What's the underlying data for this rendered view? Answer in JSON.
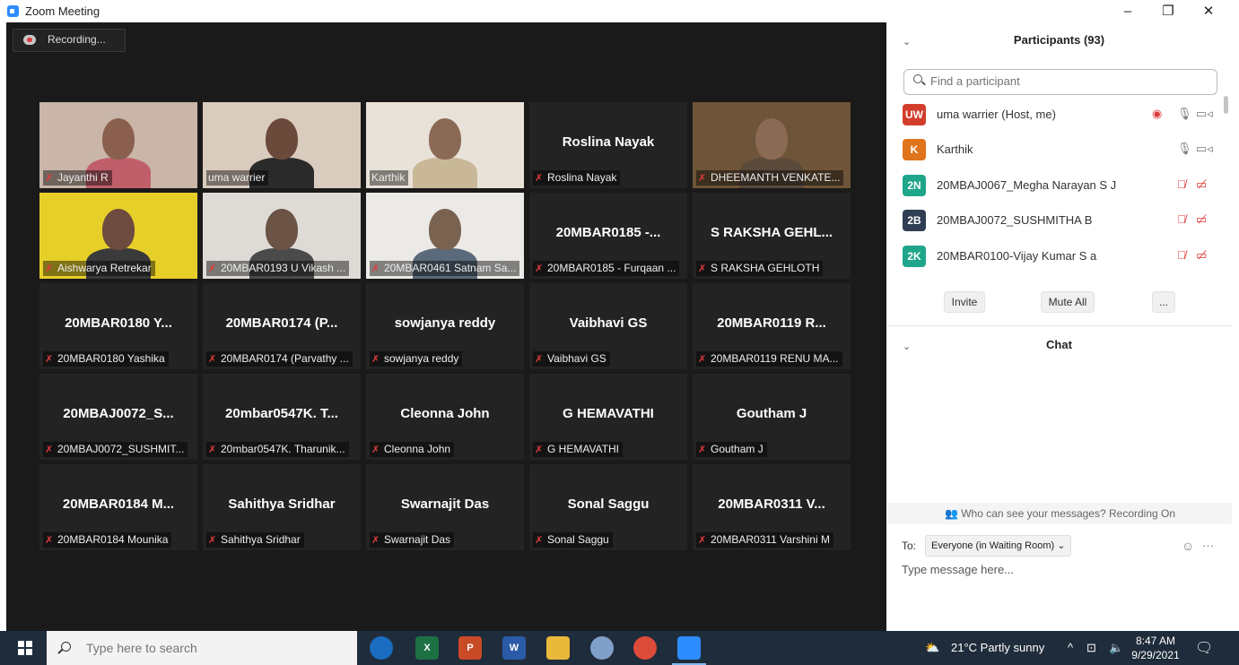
{
  "window": {
    "title": "Zoom Meeting",
    "controls": [
      "–",
      "❐",
      "✕"
    ]
  },
  "recording": {
    "label": "Recording..."
  },
  "gallery": [
    {
      "id": "jayanthi",
      "name": "",
      "label": "Jayanthi R",
      "video": true
    },
    {
      "id": "uma",
      "name": "",
      "label": "uma warrier",
      "video": true,
      "unmuted": true
    },
    {
      "id": "karthik",
      "name": "",
      "label": "Karthik",
      "video": true,
      "unmuted": true,
      "active": true
    },
    {
      "id": "roslina",
      "name": "Roslina Nayak",
      "label": "Roslina Nayak",
      "video": false
    },
    {
      "id": "dheemanth",
      "name": "",
      "label": "DHEEMANTH VENKATE...",
      "video": true
    },
    {
      "id": "aishwarya",
      "name": "",
      "label": "Aishwarya Retrekar",
      "video": true
    },
    {
      "id": "vikash",
      "name": "",
      "label": "20MBAR0193 U Vikash ...",
      "video": true
    },
    {
      "id": "satnam",
      "name": "",
      "label": "20MBAR0461 Satnam Sa...",
      "video": true
    },
    {
      "id": "furqaan",
      "name": "20MBAR0185 -...",
      "label": "20MBAR0185 - Furqaan ...",
      "video": false
    },
    {
      "id": "raksha",
      "name": "S RAKSHA GEHL...",
      "label": "S RAKSHA GEHLOTH",
      "video": false
    },
    {
      "id": "yashika",
      "name": "20MBAR0180 Y...",
      "label": "20MBAR0180 Yashika",
      "video": false
    },
    {
      "id": "parvathy",
      "name": "20MBAR0174 (P...",
      "label": "20MBAR0174 (Parvathy ...",
      "video": false
    },
    {
      "id": "sowjanya",
      "name": "sowjanya reddy",
      "label": "sowjanya reddy",
      "video": false
    },
    {
      "id": "vaibhavi",
      "name": "Vaibhavi GS",
      "label": "Vaibhavi GS",
      "video": false
    },
    {
      "id": "renu",
      "name": "20MBAR0119 R...",
      "label": "20MBAR0119 RENU MA...",
      "video": false
    },
    {
      "id": "sushmitha",
      "name": "20MBAJ0072_S...",
      "label": "20MBAJ0072_SUSHMIT...",
      "video": false
    },
    {
      "id": "tharunika",
      "name": "20mbar0547K. T...",
      "label": "20mbar0547K. Tharunik...",
      "video": false
    },
    {
      "id": "cleonna",
      "name": "Cleonna John",
      "label": "Cleonna John",
      "video": false
    },
    {
      "id": "hemavathi",
      "name": "G HEMAVATHI",
      "label": "G HEMAVATHI",
      "video": false
    },
    {
      "id": "goutham",
      "name": "Goutham J",
      "label": "Goutham J",
      "video": false
    },
    {
      "id": "mounika",
      "name": "20MBAR0184 M...",
      "label": "20MBAR0184 Mounika",
      "video": false
    },
    {
      "id": "sahithya",
      "name": "Sahithya Sridhar",
      "label": "Sahithya Sridhar",
      "video": false
    },
    {
      "id": "swarnajit",
      "name": "Swarnajit Das",
      "label": "Swarnajit Das",
      "video": false
    },
    {
      "id": "sonal",
      "name": "Sonal Saggu",
      "label": "Sonal Saggu",
      "video": false
    },
    {
      "id": "varshini",
      "name": "20MBAR0311 V...",
      "label": "20MBAR0311 Varshini M",
      "video": false
    }
  ],
  "participants": {
    "title": "Participants (93)",
    "search_placeholder": "Find a participant",
    "list": [
      {
        "initials": "UW",
        "name": "uma warrier (Host, me)",
        "color": "#d33d2c",
        "muted": false,
        "recording": true
      },
      {
        "initials": "K",
        "name": "Karthik",
        "color": "#e0741b",
        "muted": false
      },
      {
        "initials": "2N",
        "name": "20MBAJ0067_Megha Narayan S J",
        "color": "#1fa58a",
        "muted": true
      },
      {
        "initials": "2B",
        "name": "20MBAJ0072_SUSHMITHA B",
        "color": "#2f3e52",
        "muted": true
      },
      {
        "initials": "2K",
        "name": "20MBAR0100-Vijay Kumar S a",
        "color": "#1fa58a",
        "muted": true
      }
    ],
    "buttons": {
      "invite": "Invite",
      "mute_all": "Mute All",
      "more": "..."
    }
  },
  "chat": {
    "title": "Chat",
    "notice": "Who can see your messages? Recording On",
    "to_label": "To:",
    "to_value": "Everyone (in Waiting Room) ⌄",
    "placeholder": "Type message here...",
    "emoji": "☺",
    "more": "···"
  },
  "taskbar": {
    "search_placeholder": "Type here to search",
    "weather": "21°C  Partly sunny",
    "time": "8:47 AM",
    "date": "9/29/2021"
  }
}
